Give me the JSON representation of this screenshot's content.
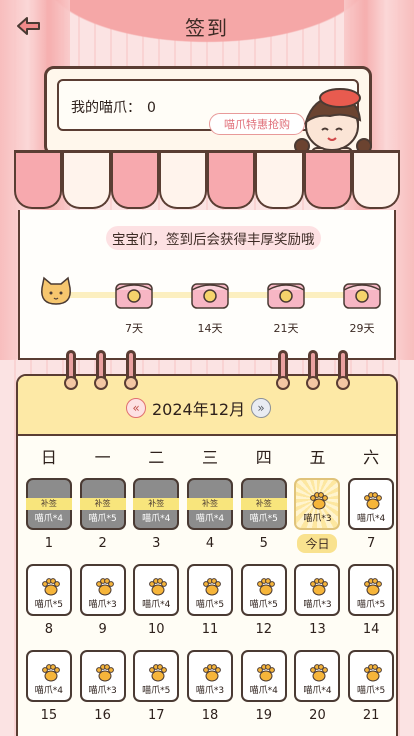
{
  "header": {
    "title": "签到"
  },
  "board": {
    "paw_label": "我的喵爪：",
    "paw_count": "0",
    "promo_button": "喵爪特惠抢购"
  },
  "rewards": {
    "notice": "宝宝们，签到后会获得丰厚奖励哦",
    "milestones": [
      "7天",
      "14天",
      "21天",
      "29天"
    ]
  },
  "calendar": {
    "month": "2024年12月",
    "weekdays": [
      "日",
      "一",
      "二",
      "三",
      "四",
      "五",
      "六"
    ],
    "today_label": "今日",
    "makeup_label": "补签",
    "weeks": [
      [
        {
          "day": "1",
          "reward": "喵爪*4",
          "status": "makeup"
        },
        {
          "day": "2",
          "reward": "喵爪*5",
          "status": "makeup"
        },
        {
          "day": "3",
          "reward": "喵爪*4",
          "status": "makeup"
        },
        {
          "day": "4",
          "reward": "喵爪*4",
          "status": "makeup"
        },
        {
          "day": "5",
          "reward": "喵爪*5",
          "status": "makeup"
        },
        {
          "day": "今日",
          "reward": "喵爪*3",
          "status": "today"
        },
        {
          "day": "7",
          "reward": "喵爪*4",
          "status": "future"
        }
      ],
      [
        {
          "day": "8",
          "reward": "喵爪*5",
          "status": "future"
        },
        {
          "day": "9",
          "reward": "喵爪*3",
          "status": "future"
        },
        {
          "day": "10",
          "reward": "喵爪*4",
          "status": "future"
        },
        {
          "day": "11",
          "reward": "喵爪*5",
          "status": "future"
        },
        {
          "day": "12",
          "reward": "喵爪*5",
          "status": "future"
        },
        {
          "day": "13",
          "reward": "喵爪*3",
          "status": "future"
        },
        {
          "day": "14",
          "reward": "喵爪*5",
          "status": "future"
        }
      ],
      [
        {
          "day": "15",
          "reward": "喵爪*4",
          "status": "future"
        },
        {
          "day": "16",
          "reward": "喵爪*3",
          "status": "future"
        },
        {
          "day": "17",
          "reward": "喵爪*5",
          "status": "future"
        },
        {
          "day": "18",
          "reward": "喵爪*3",
          "status": "future"
        },
        {
          "day": "19",
          "reward": "喵爪*4",
          "status": "future"
        },
        {
          "day": "20",
          "reward": "喵爪*4",
          "status": "future"
        },
        {
          "day": "21",
          "reward": "喵爪*5",
          "status": "future"
        }
      ]
    ]
  },
  "colors": {
    "accent_pink": "#f7a9ae",
    "calendar_header": "#fde9a6",
    "signed_gray": "#8c8c8c",
    "outline": "#5a3d33"
  },
  "icons": [
    "back-arrow-icon",
    "cat-icon",
    "treasure-chest-icon",
    "paw-icon",
    "prev-month-icon",
    "next-month-icon"
  ]
}
